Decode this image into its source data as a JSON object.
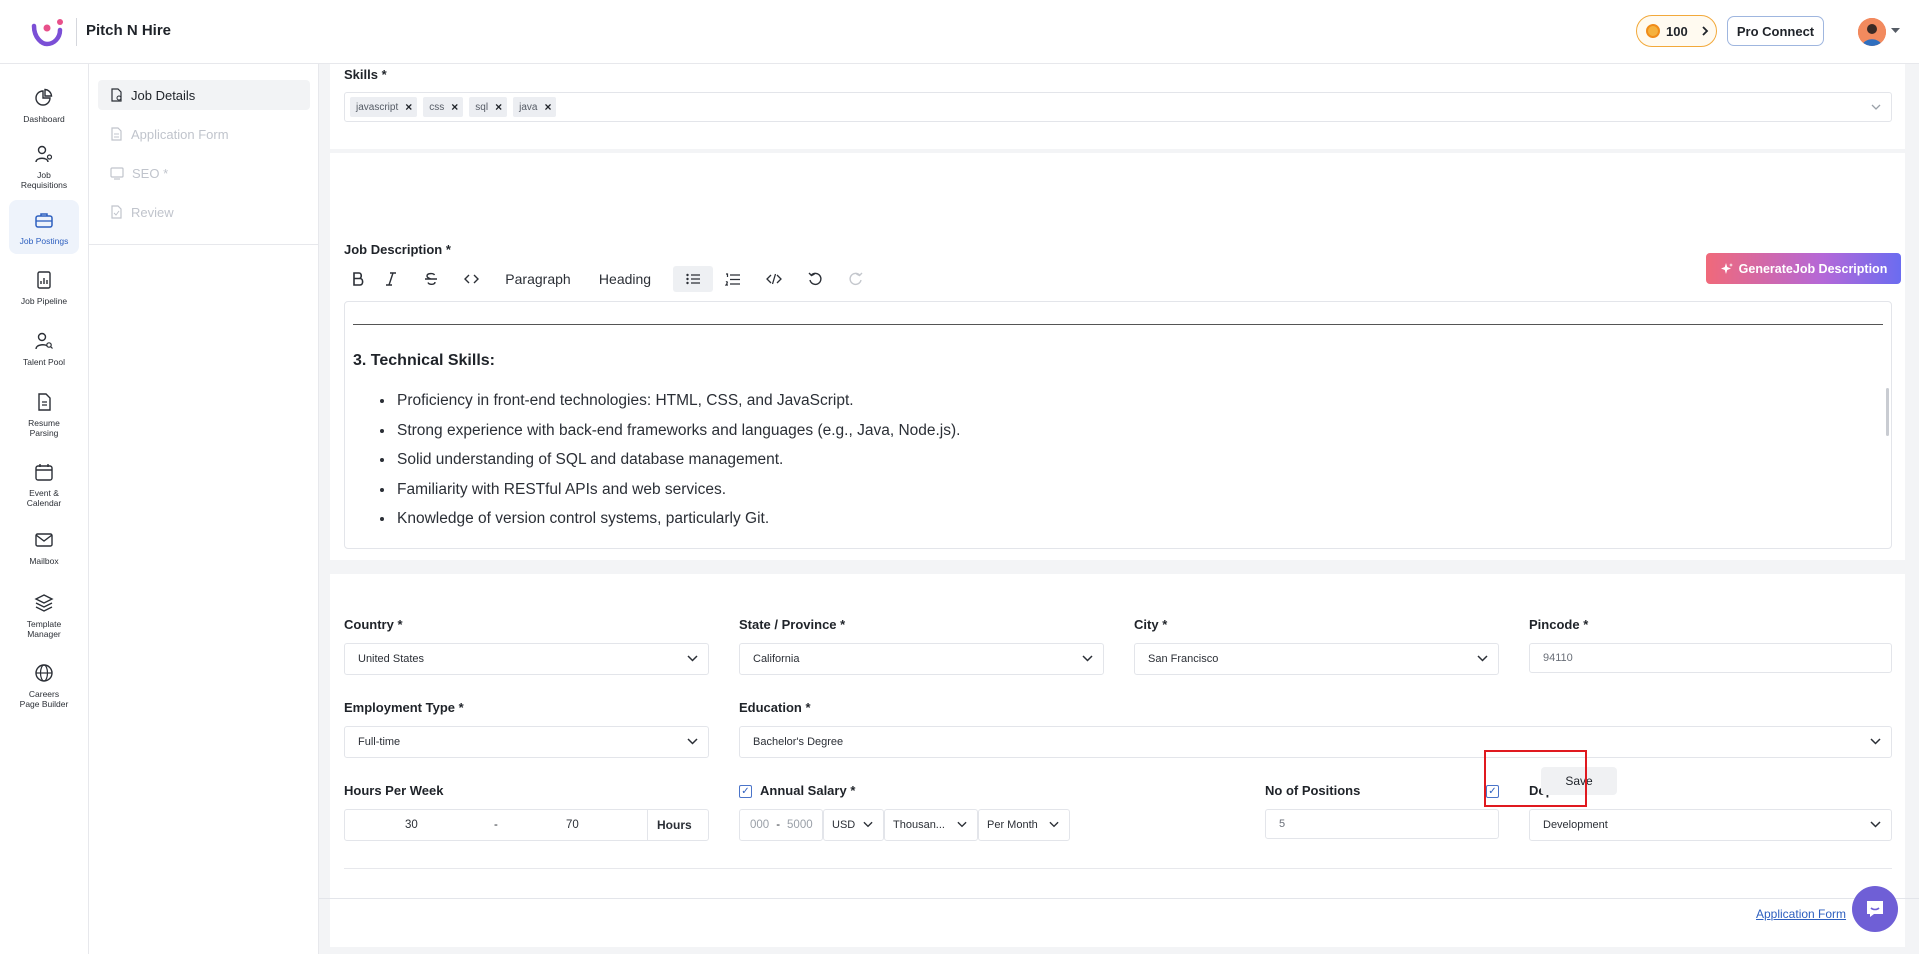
{
  "app": {
    "brand": "Pitch N Hire",
    "coins": "100",
    "pro_connect": "Pro Connect"
  },
  "rail": {
    "items": [
      {
        "label": "Dashboard",
        "icon": "pie-chart-icon"
      },
      {
        "label": "Job Requisitions",
        "icon": "user-key-icon"
      },
      {
        "label": "Job Postings",
        "icon": "briefcase-icon",
        "active": true
      },
      {
        "label": "Job Pipeline",
        "icon": "report-icon"
      },
      {
        "label": "Talent Pool",
        "icon": "user-search-icon"
      },
      {
        "label": "Resume Parsing",
        "icon": "document-icon"
      },
      {
        "label": "Event & Calendar",
        "icon": "calendar-icon"
      },
      {
        "label": "Mailbox",
        "icon": "mail-icon"
      },
      {
        "label": "Template Manager",
        "icon": "layers-icon"
      },
      {
        "label": "Careers Page Builder",
        "icon": "globe-icon"
      }
    ]
  },
  "subnav": {
    "items": [
      {
        "label": "Job Details",
        "active": true
      },
      {
        "label": "Application Form"
      },
      {
        "label": "SEO *"
      },
      {
        "label": "Review"
      }
    ]
  },
  "skills": {
    "label": "Skills",
    "required": "*",
    "chips": [
      "javascript",
      "css",
      "sql",
      "java"
    ]
  },
  "description": {
    "label": "Job Description",
    "required": "*",
    "generate_label": "GenerateJob Description",
    "toolbar": {
      "paragraph": "Paragraph",
      "heading": "Heading"
    },
    "section_title": "3. Technical Skills:",
    "bullets": [
      "Proficiency in front-end technologies: HTML, CSS, and JavaScript.",
      "Strong experience with back-end frameworks and languages (e.g., Java, Node.js).",
      "Solid understanding of SQL and database management.",
      "Familiarity with RESTful APIs and web services.",
      "Knowledge of version control systems, particularly Git."
    ]
  },
  "form": {
    "country": {
      "label": "Country",
      "required": "*",
      "value": "United States"
    },
    "state": {
      "label": "State / Province",
      "required": "*",
      "value": "California"
    },
    "city": {
      "label": "City",
      "required": "*",
      "value": "San Francisco"
    },
    "pincode": {
      "label": "Pincode",
      "required": "*",
      "value": "94110"
    },
    "employment_type": {
      "label": "Employment Type",
      "required": "*",
      "value": "Full-time"
    },
    "education": {
      "label": "Education",
      "required": "*",
      "value": "Bachelor's Degree"
    },
    "hours": {
      "label": "Hours Per Week",
      "min": "30",
      "dash": "-",
      "max": "70",
      "unit": "Hours"
    },
    "salary": {
      "label": "Annual Salary",
      "required": "*",
      "min": "000",
      "dash": "-",
      "max": "5000",
      "currency": "USD",
      "scale": "Thousan...",
      "period": "Per Month",
      "checked": true
    },
    "positions": {
      "label": "No of Positions",
      "value": "5",
      "checked": true
    },
    "department": {
      "label": "Department",
      "value": "Development"
    }
  },
  "actions": {
    "save": "Save",
    "footer_link": "Application Form"
  },
  "colors": {
    "accent": "#2d5fbf",
    "highlight": "#e0191f",
    "chat": "#6f5fd6"
  }
}
